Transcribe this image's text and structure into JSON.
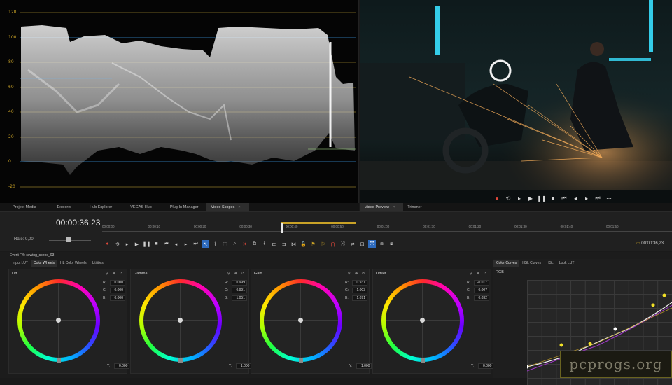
{
  "scope": {
    "labels": [
      "120",
      "100",
      "80",
      "60",
      "40",
      "20",
      "0",
      "-20"
    ],
    "accent": "#c9a227"
  },
  "panel_tabs_left": [
    {
      "label": "Project Media"
    },
    {
      "label": "Explorer"
    },
    {
      "label": "Hub Explorer"
    },
    {
      "label": "VEGAS Hub"
    },
    {
      "label": "Plug-In Manager"
    },
    {
      "label": "Video Scopes",
      "active": true
    }
  ],
  "panel_tabs_right": [
    {
      "label": "Video Preview",
      "active": true
    },
    {
      "label": "Trimmer"
    }
  ],
  "timeline": {
    "timecode": "00:00:36,23",
    "rate_label": "Rate: 0,00",
    "ruler": [
      "00:00:00",
      "00:00:10",
      "00:00:20",
      "00:00:30",
      "00:00:40",
      "00:00:50",
      "00:01:00",
      "00:01:10",
      "00:01:20",
      "00:01:30",
      "00:01:40",
      "00:01:50"
    ],
    "cursor_timecode": "00:00:36,23"
  },
  "fx": {
    "header": "Event FX: sewing_scene_03",
    "tabs": [
      {
        "label": "Input LUT"
      },
      {
        "label": "Color Wheels",
        "active": true
      },
      {
        "label": "HL Color Wheels"
      },
      {
        "label": "Utilities"
      }
    ],
    "wheels": [
      {
        "title": "Lift",
        "r": "0.000",
        "g": "0.000",
        "b": "0.000",
        "y": "0.000"
      },
      {
        "title": "Gamma",
        "r": "0.999",
        "g": "0.991",
        "b": "1.051",
        "y": "1.000"
      },
      {
        "title": "Gain",
        "r": "0.931",
        "g": "1.003",
        "b": "1.091",
        "y": "1.000"
      },
      {
        "title": "Offset",
        "r": "-0.017",
        "g": "-0.007",
        "b": "0.032",
        "y": "0.000"
      }
    ],
    "rgb_labels": {
      "r": "R:",
      "g": "G:",
      "b": "B:",
      "y": "Y:"
    }
  },
  "curves": {
    "tabs": [
      {
        "label": "Color Curves",
        "active": true
      },
      {
        "label": "HSL Curves"
      },
      {
        "label": "HSL"
      },
      {
        "label": "Look LUT"
      }
    ],
    "channel": "RGB"
  },
  "watermark": "pcprogs.org"
}
